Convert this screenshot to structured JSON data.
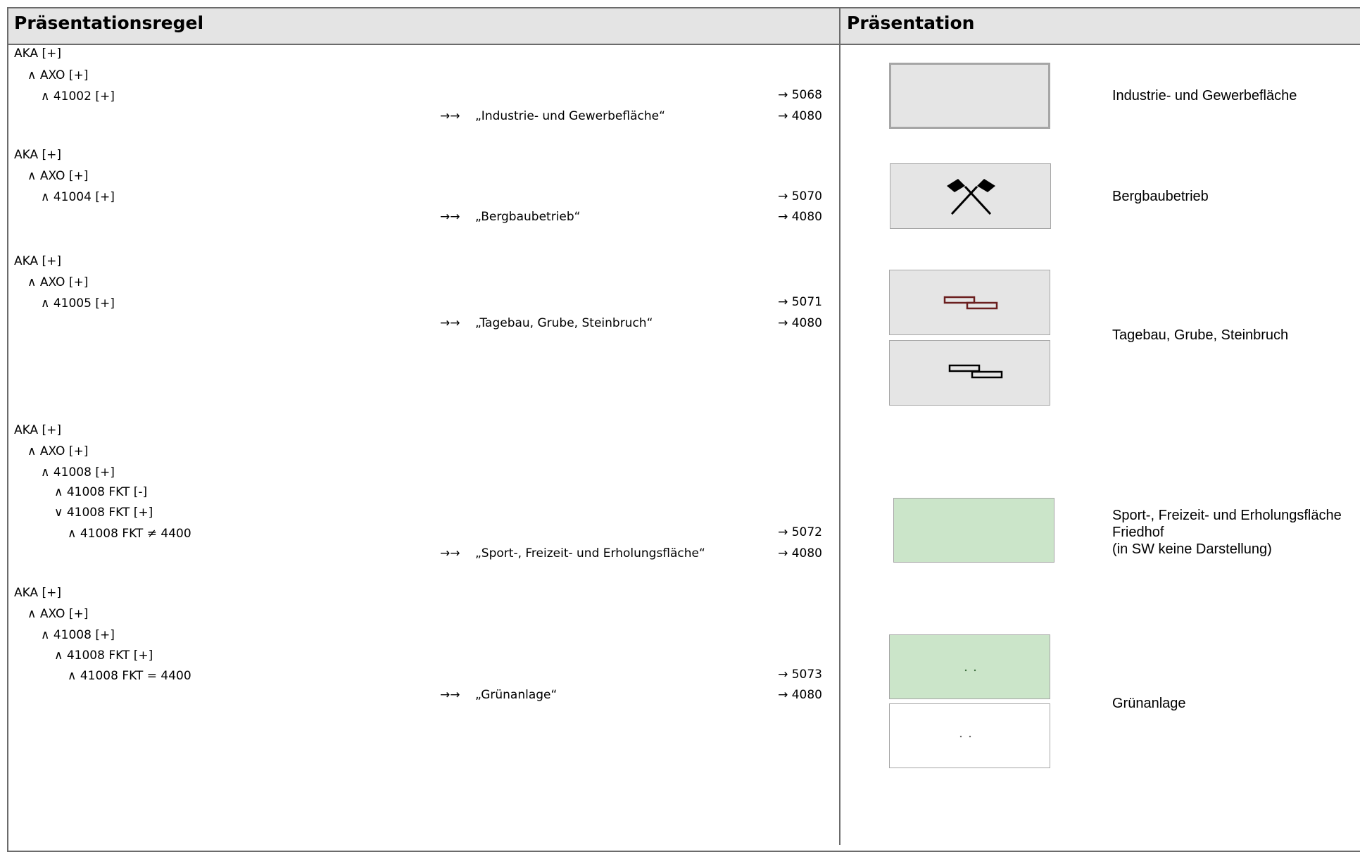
{
  "header": {
    "left_title": "Präsentationsregel",
    "right_title": "Präsentation"
  },
  "rules": [
    {
      "lines": [
        "AKA [+]",
        "∧ AXO [+]",
        "∧ 41002 [+]"
      ],
      "arrow": "→→",
      "name": "„Industrie- und Gewerbefläche“",
      "codes": [
        "→ 5068",
        "→ 4080"
      ]
    },
    {
      "lines": [
        "AKA [+]",
        "∧ AXO [+]",
        "∧ 41004 [+]"
      ],
      "arrow": "→→",
      "name": "„Bergbaubetrieb“",
      "codes": [
        "→ 5070",
        "→ 4080"
      ]
    },
    {
      "lines": [
        "AKA [+]",
        "∧ AXO [+]",
        "∧ 41005 [+]"
      ],
      "arrow": "→→",
      "name": "„Tagebau, Grube, Steinbruch“",
      "codes": [
        "→ 5071",
        "→ 4080"
      ]
    },
    {
      "lines": [
        "AKA [+]",
        "∧ AXO [+]",
        "∧ 41008 [+]",
        "∧ 41008 FKT [-]",
        "∨ 41008 FKT [+]",
        "∧ 41008 FKT ≠ 4400"
      ],
      "arrow": "→→",
      "name": "„Sport-, Freizeit- und Erholungsfläche“",
      "codes": [
        "→ 5072",
        "→ 4080"
      ]
    },
    {
      "lines": [
        "AKA [+]",
        "∧ AXO [+]",
        "∧ 41008 [+]",
        "∧ 41008 FKT [+]",
        "∧ 41008 FKT = 4400"
      ],
      "arrow": "→→",
      "name": "„Grünanlage“",
      "codes": [
        "→ 5073",
        "→ 4080"
      ]
    }
  ],
  "presentation": {
    "labels": {
      "industrie": "Industrie- und Gewerbefläche",
      "bergbau": "Bergbaubetrieb",
      "tagebau": "Tagebau, Grube, Steinbruch",
      "sport_line1": "Sport-, Freizeit- und Erholungsfläche",
      "sport_line2": "Friedhof",
      "sport_line3": "(in SW keine Darstellung)",
      "gruen": "Grünanlage"
    },
    "colors": {
      "grey_fill": "#e5e5e5",
      "green_fill": "#cbe5c9",
      "border": "#a6a6a6",
      "tagebau_color": "#6b1f1f"
    }
  }
}
